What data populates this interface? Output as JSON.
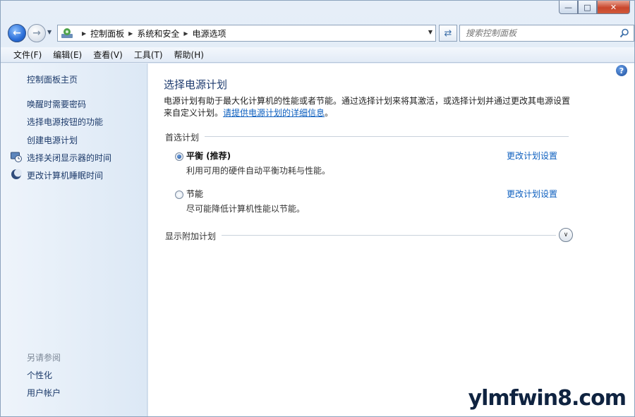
{
  "window": {
    "caption": {
      "minimize": "—",
      "maximize": "□",
      "close": "✕"
    }
  },
  "address": {
    "crumbs": [
      "控制面板",
      "系统和安全",
      "电源选项"
    ],
    "search_placeholder": "搜索控制面板"
  },
  "menu": [
    "文件(F)",
    "编辑(E)",
    "查看(V)",
    "工具(T)",
    "帮助(H)"
  ],
  "sidebar": {
    "home": "控制面板主页",
    "links": [
      "唤醒时需要密码",
      "选择电源按钮的功能",
      "创建电源计划",
      "选择关闭显示器的时间",
      "更改计算机睡眠时间"
    ],
    "see_also_title": "另请参阅",
    "see_also": [
      "个性化",
      "用户帐户"
    ]
  },
  "main": {
    "title": "选择电源计划",
    "intro": "电源计划有助于最大化计算机的性能或者节能。通过选择计划来将其激活，或选择计划并通过更改其电源设置来自定义计划。",
    "intro_link": "请提供电源计划的详细信息",
    "intro_end": "。",
    "preferred_head": "首选计划",
    "plans": [
      {
        "name": "平衡 (推荐)",
        "desc": "利用可用的硬件自动平衡功耗与性能。",
        "link": "更改计划设置",
        "selected": true
      },
      {
        "name": "节能",
        "desc": "尽可能降低计算机性能以节能。",
        "link": "更改计划设置",
        "selected": false
      }
    ],
    "more_head": "显示附加计划"
  },
  "watermark": "ylmfwin8.com",
  "colors": {
    "link": "#0d5fbf",
    "title": "#1e3b6f",
    "sidebar": "#1c3a6a"
  }
}
